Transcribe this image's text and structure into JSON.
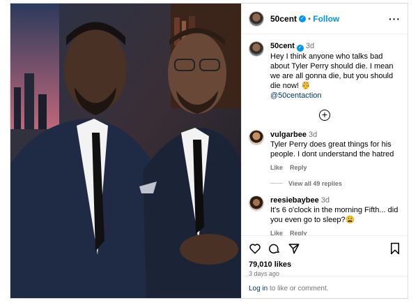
{
  "post": {
    "username": "50cent",
    "follow_label": "Follow",
    "more_label": "···"
  },
  "caption": {
    "username": "50cent",
    "time": "3d",
    "text": "Hey I think anyone who talks bad about Tyler Perry should die. I mean we are all gonna die, but you should die now! 🤴",
    "mention": "@50centaction"
  },
  "load_more_icon": "plus-circle-icon",
  "comments": [
    {
      "username": "vulgarbee",
      "time": "3d",
      "text": "Tyler Perry does great things for his people. I dont understand the hatred",
      "like_label": "Like",
      "reply_label": "Reply",
      "view_replies": "View all 49 replies"
    },
    {
      "username": "reesiebaybee",
      "time": "3d",
      "text": "It's 6 o'clock in the morning Fifth... did you even go to sleep?😩",
      "like_label": "Like",
      "reply_label": "Reply"
    }
  ],
  "actions": {
    "icons": [
      "heart-icon",
      "comment-icon",
      "share-icon",
      "bookmark-icon"
    ],
    "likes": "79,010 likes",
    "posted": "3 days ago"
  },
  "login": {
    "link": "Log in",
    "rest": " to like or comment."
  },
  "colors": {
    "link_blue": "#0095f6",
    "mention_blue": "#00376b",
    "muted": "#737373"
  }
}
